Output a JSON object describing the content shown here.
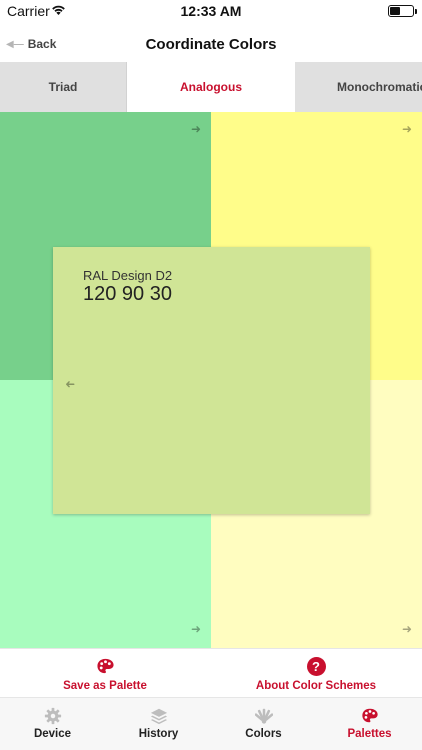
{
  "status_bar": {
    "carrier": "Carrier",
    "time": "12:33 AM",
    "battery_level": 0.45
  },
  "nav": {
    "back_label": "Back",
    "title": "Coordinate Colors"
  },
  "tabs": [
    {
      "label": "Triad",
      "active": false
    },
    {
      "label": "Analogous",
      "active": true
    },
    {
      "label": "Monochromatic",
      "active": false
    }
  ],
  "swatches": {
    "top_left": {
      "color": "#77d08b"
    },
    "top_right": {
      "color": "#fffd8a"
    },
    "bottom_left": {
      "color": "#a8fcbe"
    },
    "bottom_right": {
      "color": "#fffdc0"
    }
  },
  "selected_color": {
    "name": "RAL Design D2",
    "code": "120 90 30",
    "color": "#d0e596"
  },
  "actions": {
    "save_label": "Save as Palette",
    "about_label": "About Color Schemes"
  },
  "tabbar": [
    {
      "label": "Device",
      "icon": "gear-icon",
      "active": false
    },
    {
      "label": "History",
      "icon": "layers-icon",
      "active": false
    },
    {
      "label": "Colors",
      "icon": "fan-deck-icon",
      "active": false
    },
    {
      "label": "Palettes",
      "icon": "palette-icon",
      "active": true
    }
  ],
  "colors": {
    "accent": "#c8102e"
  }
}
